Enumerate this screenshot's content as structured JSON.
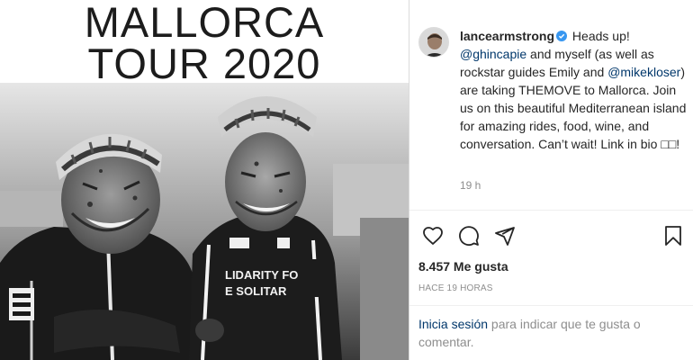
{
  "poster": {
    "title_line1": "MALLORCA",
    "title_line2": "TOUR 2020",
    "jersey_text_left": "LIDARITY FO",
    "jersey_text_right": "E SOLITAR"
  },
  "post": {
    "username": "lancеarmstrong",
    "caption_parts": {
      "p1": " Heads up! ",
      "mention1": "@ghincapie",
      "p2": " and myself (as well as rockstar guides Emily and ",
      "mention2": "@mikekloser",
      "p3": ") are taking THEMOVE to Mallorca. Join us on this beautiful Mediterranean island for amazing rides, food, wine, and conversation. Can’t wait! Link in bio □□!"
    },
    "time_ago": "19 h",
    "likes": "8.457 Me gusta",
    "date": "HACE 19 HORAS"
  },
  "login": {
    "link": "Inicia sesión",
    "rest": " para indicar que te gusta o comentar."
  },
  "icons": {
    "verified": "verified-badge-icon",
    "like": "heart-icon",
    "comment": "comment-icon",
    "share": "paper-plane-icon",
    "save": "bookmark-icon"
  },
  "colors": {
    "verified": "#3897f0",
    "link": "#00376b",
    "muted": "#8e8e8e",
    "text": "#262626"
  }
}
